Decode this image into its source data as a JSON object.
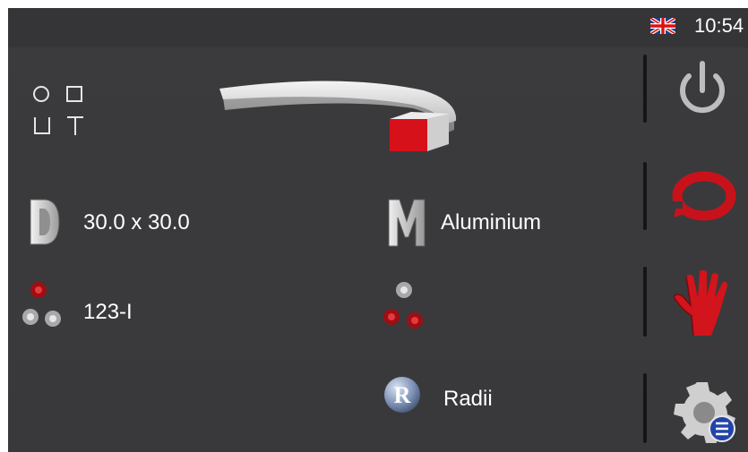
{
  "status": {
    "language_flag": "uk-flag-icon",
    "time": "10:54"
  },
  "profile": {
    "shape_icons": "profile-shape-icons",
    "preview_image": "bent-square-profile-image",
    "highlight_color": "#e0161a"
  },
  "dimension": {
    "icon": "dimension-d-icon",
    "value": "30.0 x 30.0"
  },
  "material": {
    "icon": "material-m-icon",
    "value": "Aluminium"
  },
  "tooling": {
    "icon": "roll-set-icon",
    "value": "123-I"
  },
  "roll_config": {
    "icon": "roll-config-icon"
  },
  "radii": {
    "icon": "radii-r-icon",
    "label": "Radii"
  },
  "side_menu": {
    "power": "power-icon",
    "cycle": "cycle-icon",
    "manual": "manual-hand-icon",
    "settings": "settings-gear-icon"
  },
  "colors": {
    "background": "#3a3a3c",
    "accent_red": "#d6111a",
    "text": "#ffffff"
  }
}
